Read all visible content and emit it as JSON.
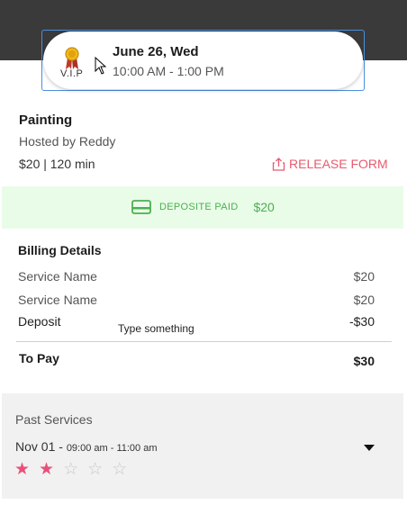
{
  "booking": {
    "badge_label": "V.I.P",
    "date": "June 26, Wed",
    "time": "10:00 AM - 1:00 PM"
  },
  "service": {
    "title": "Painting",
    "host": "Hosted by Reddy",
    "meta": "$20 |  120 min",
    "release_form_label": "RELEASE FORM"
  },
  "deposit": {
    "label": "DEPOSITE PAID",
    "amount": "$20"
  },
  "billing": {
    "title": "Billing Details",
    "rows": [
      {
        "label": "Service Name",
        "amount": "$20"
      },
      {
        "label": "Service Name",
        "amount": "$20"
      },
      {
        "label": "Deposit",
        "amount": "-$30"
      }
    ],
    "note_placeholder": "Type something",
    "to_pay_label": "To Pay",
    "to_pay_amount": "$30"
  },
  "past_services": {
    "title": "Past Services",
    "date": "Nov 01 - ",
    "time": "09:00 am - 11:00 am",
    "rating": 2,
    "max_rating": 5
  },
  "colors": {
    "accent_pink": "#e85a6e",
    "deposit_green": "#4caf50",
    "star_filled": "#e8507a",
    "header_dark": "#3a3a3a"
  }
}
